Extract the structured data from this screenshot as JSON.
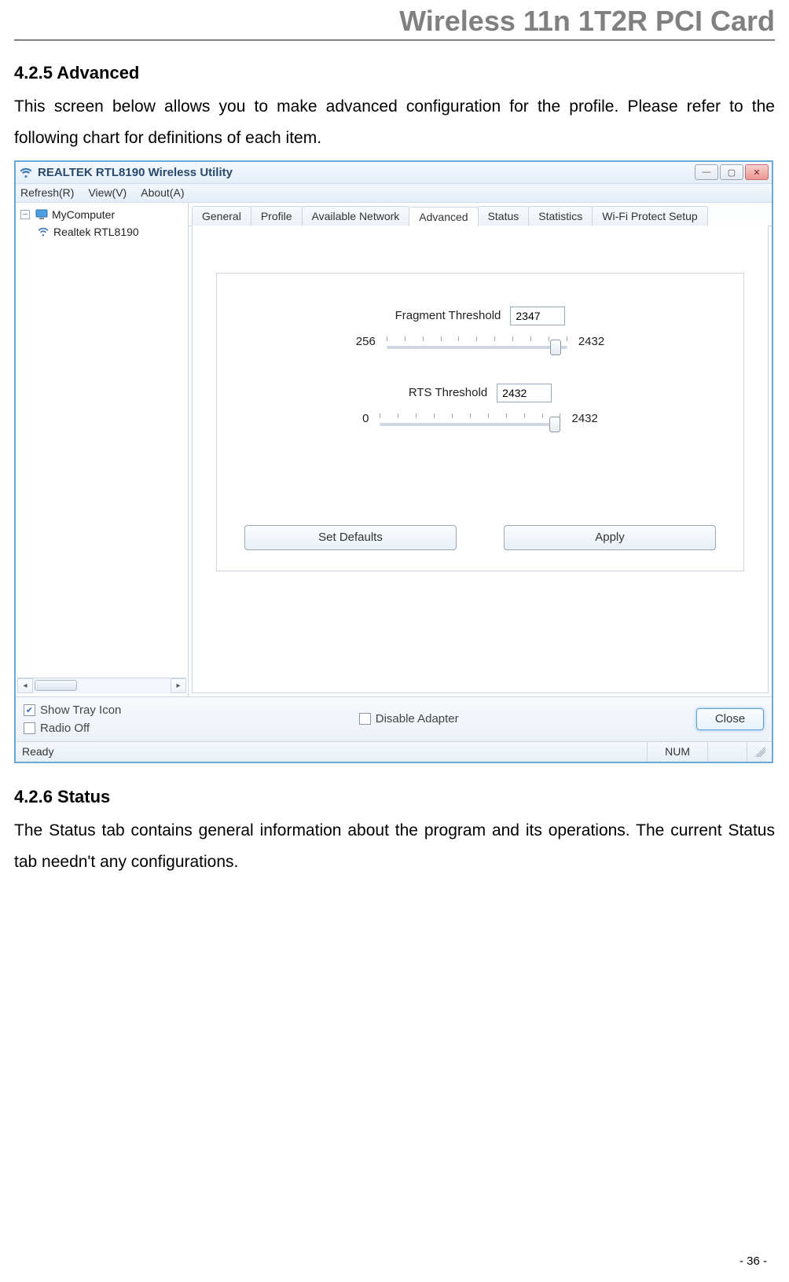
{
  "doc": {
    "header": "Wireless 11n 1T2R PCI Card",
    "section_425_heading": "4.2.5  Advanced",
    "section_425_body": "This screen below allows you to make advanced configuration for the profile. Please refer to the following chart for definitions of each item.",
    "section_426_heading": "4.2.6 Status",
    "section_426_body": "The Status tab contains general information about the program and its operations. The current Status tab needn't any configurations.",
    "page_number": "- 36 -"
  },
  "app": {
    "title": "REALTEK RTL8190 Wireless Utility",
    "menu": {
      "refresh": "Refresh(R)",
      "view": "View(V)",
      "about": "About(A)"
    },
    "tree": {
      "root": "MyComputer",
      "child": "Realtek RTL8190"
    },
    "tabs": {
      "general": "General",
      "profile": "Profile",
      "available": "Available Network",
      "advanced": "Advanced",
      "status": "Status",
      "statistics": "Statistics",
      "wps": "Wi-Fi Protect Setup"
    },
    "advanced_panel": {
      "fragment_label": "Fragment Threshold",
      "fragment_value": "2347",
      "fragment_min": "256",
      "fragment_max": "2432",
      "rts_label": "RTS Threshold",
      "rts_value": "2432",
      "rts_min": "0",
      "rts_max": "2432",
      "set_defaults": "Set Defaults",
      "apply": "Apply"
    },
    "bottom": {
      "show_tray": "Show Tray Icon",
      "radio_off": "Radio Off",
      "disable_adapter": "Disable Adapter",
      "close": "Close"
    },
    "status": {
      "ready": "Ready",
      "num": "NUM"
    }
  }
}
